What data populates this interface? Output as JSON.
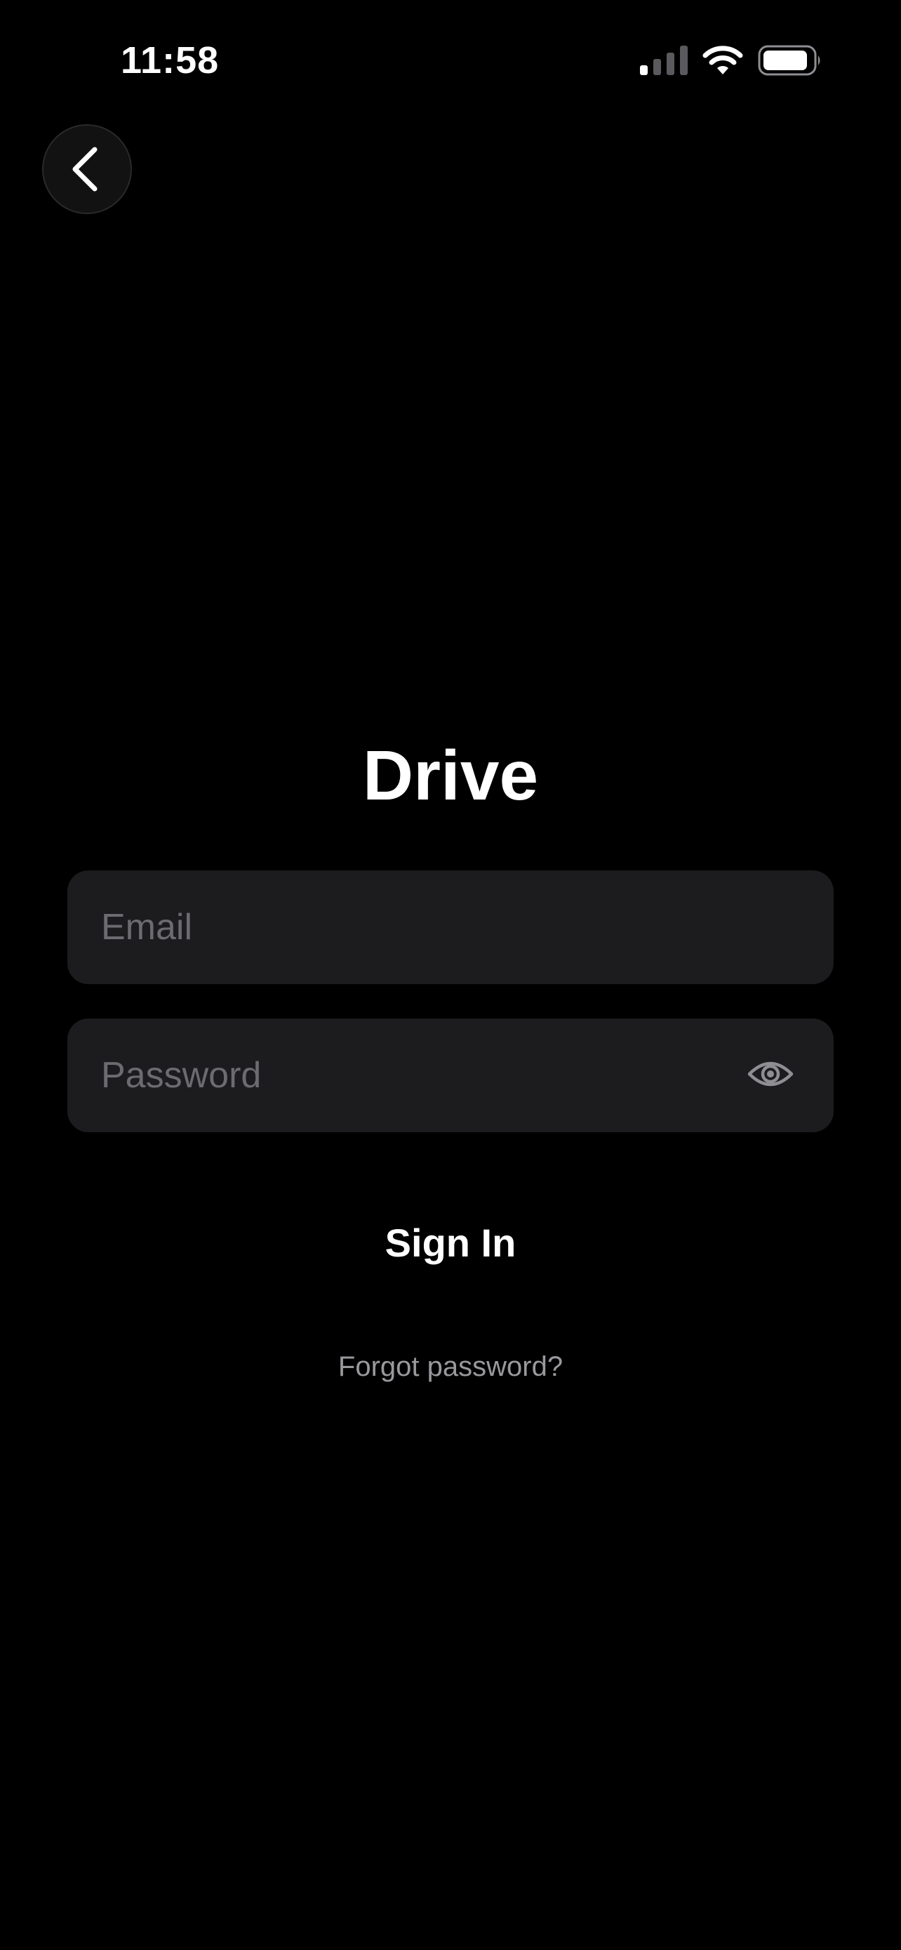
{
  "status_bar": {
    "time": "11:58",
    "icons": [
      "cellular-signal-icon",
      "wifi-icon",
      "battery-icon"
    ]
  },
  "navigation": {
    "back_icon": "chevron-left-icon"
  },
  "login": {
    "title": "Drive",
    "email_placeholder": "Email",
    "email_value": "",
    "password_placeholder": "Password",
    "password_value": "",
    "password_toggle_icon": "eye-icon",
    "sign_in_label": "Sign In",
    "forgot_password_label": "Forgot password?"
  },
  "colors": {
    "background": "#000000",
    "field_background": "#1c1c1e",
    "placeholder": "#6b6b70",
    "secondary_text": "#98989d",
    "primary_text": "#ffffff"
  }
}
